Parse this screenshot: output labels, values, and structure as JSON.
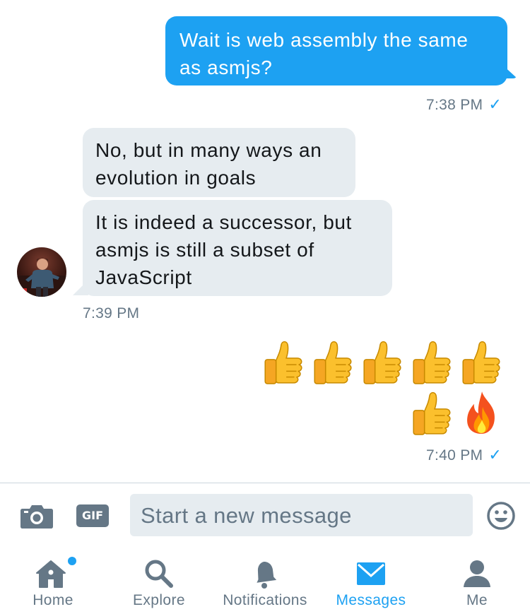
{
  "conversation": {
    "messages": [
      {
        "direction": "outgoing",
        "lines": [
          "Wait is web assembly the same",
          "as asmjs?"
        ]
      },
      {
        "direction": "incoming",
        "lines": [
          "No, but in many ways an",
          "evolution in goals"
        ]
      },
      {
        "direction": "incoming",
        "lines": [
          "It is indeed a successor, but",
          "asmjs is still a subset of",
          "JavaScript"
        ]
      }
    ],
    "timestamps": [
      "7:38 PM",
      "7:39 PM",
      "7:40 PM"
    ],
    "read_check": "✓",
    "emoji_message": [
      "thumbs-up",
      "thumbs-up",
      "thumbs-up",
      "thumbs-up",
      "thumbs-up",
      "thumbs-up",
      "fire"
    ]
  },
  "compose": {
    "placeholder": "Start a new message",
    "gif_label": "GIF",
    "icons": [
      "camera-icon",
      "gif-icon",
      "emoji-icon"
    ]
  },
  "tabbar": {
    "tabs": [
      {
        "label": "Home",
        "icon": "home-icon",
        "badge": true,
        "active": false
      },
      {
        "label": "Explore",
        "icon": "search-icon",
        "active": false
      },
      {
        "label": "Notifications",
        "icon": "bell-icon",
        "active": false
      },
      {
        "label": "Messages",
        "icon": "envelope-icon",
        "active": true
      },
      {
        "label": "Me",
        "icon": "person-icon",
        "active": false
      }
    ]
  },
  "colors": {
    "accent": "#1da1f2",
    "incoming_bubble": "#e6ecf0",
    "muted_text": "#657786",
    "icon_gray": "#657786"
  }
}
